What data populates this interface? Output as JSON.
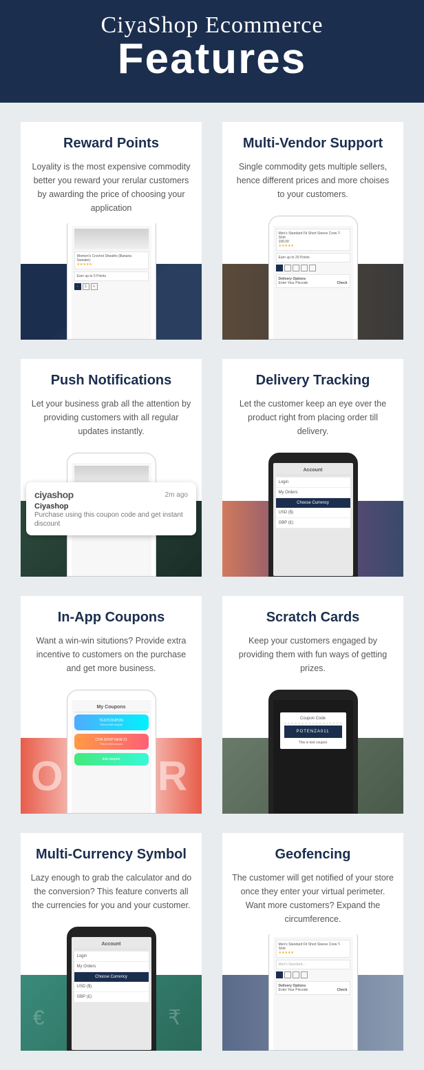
{
  "header": {
    "script": "CiyaShop Ecommerce",
    "big": "Features"
  },
  "features": [
    {
      "title": "Reward Points",
      "desc": "Loyality is the most expensive commodity better you reward your rerular customers by awarding the price of choosing your application",
      "bg": "bg1"
    },
    {
      "title": "Multi-Vendor Support",
      "desc": "Single commodity gets multiple sellers, hence different prices and more choises to your customers.",
      "bg": "bg2"
    },
    {
      "title": "Push Notifications",
      "desc": "Let your business grab all the attention by providing customers with all regular updates instantly.",
      "bg": "bg3"
    },
    {
      "title": "Delivery Tracking",
      "desc": "Let the customer keep an eye over the product right from placing order till delivery.",
      "bg": "bg4"
    },
    {
      "title": "In-App Coupons",
      "desc": "Want a win-win situtions? Provide extra incentive to customers on the purchase and get more business.",
      "bg": "bg5"
    },
    {
      "title": "Scratch Cards",
      "desc": "Keep your customers engaged by providing them with fun ways of getting prizes.",
      "bg": "bg6"
    },
    {
      "title": "Multi-Currency Symbol",
      "desc": "Lazy enough to grab the calculator and do the conversion? This feature converts all the currencies for you and your customer.",
      "bg": "bg7"
    },
    {
      "title": "Geofencing",
      "desc": "The customer will get notified of your store once they enter your virtual perimeter. Want more customers? Expand the circumference.",
      "bg": "bg8"
    }
  ],
  "phone": {
    "reward_item": "Women's Crochet Sheaths (Banana Sweater)",
    "reward_upto": "Earn up to 5 Points",
    "product_title": "Men's Standard Fit Short Sleeve Crew T-Shirt",
    "product_price": "199.00",
    "upto20": "Earn up to 20 Points",
    "delivery_opts": "Delivery Options",
    "enter_pincode": "Enter Your Pincode",
    "check": "Check",
    "search_ph": "Men's Standard...",
    "coupons_title": "My Coupons",
    "coupon1": "TESTCOUPON",
    "coupon1_sub": "This is test coupon",
    "coupon2": "CIYA SHOP NEW 21",
    "coupon2_sub": "This is test coupon",
    "coupon3": "test coupon",
    "account": "Account",
    "login": "Login",
    "my_orders": "My Orders",
    "choose_curr": "Choose Currency",
    "usd": "USD ($)",
    "gbp": "GBP (£)",
    "scratch_title": "Coupon Code",
    "scratch_code": "POTENZA011",
    "scratch_sub": "This is test coupon"
  },
  "notif": {
    "logo": "ciyashop",
    "time": "2m ago",
    "title": "Ciyashop",
    "body": "Purchase using this coupon code and get instant discount"
  }
}
